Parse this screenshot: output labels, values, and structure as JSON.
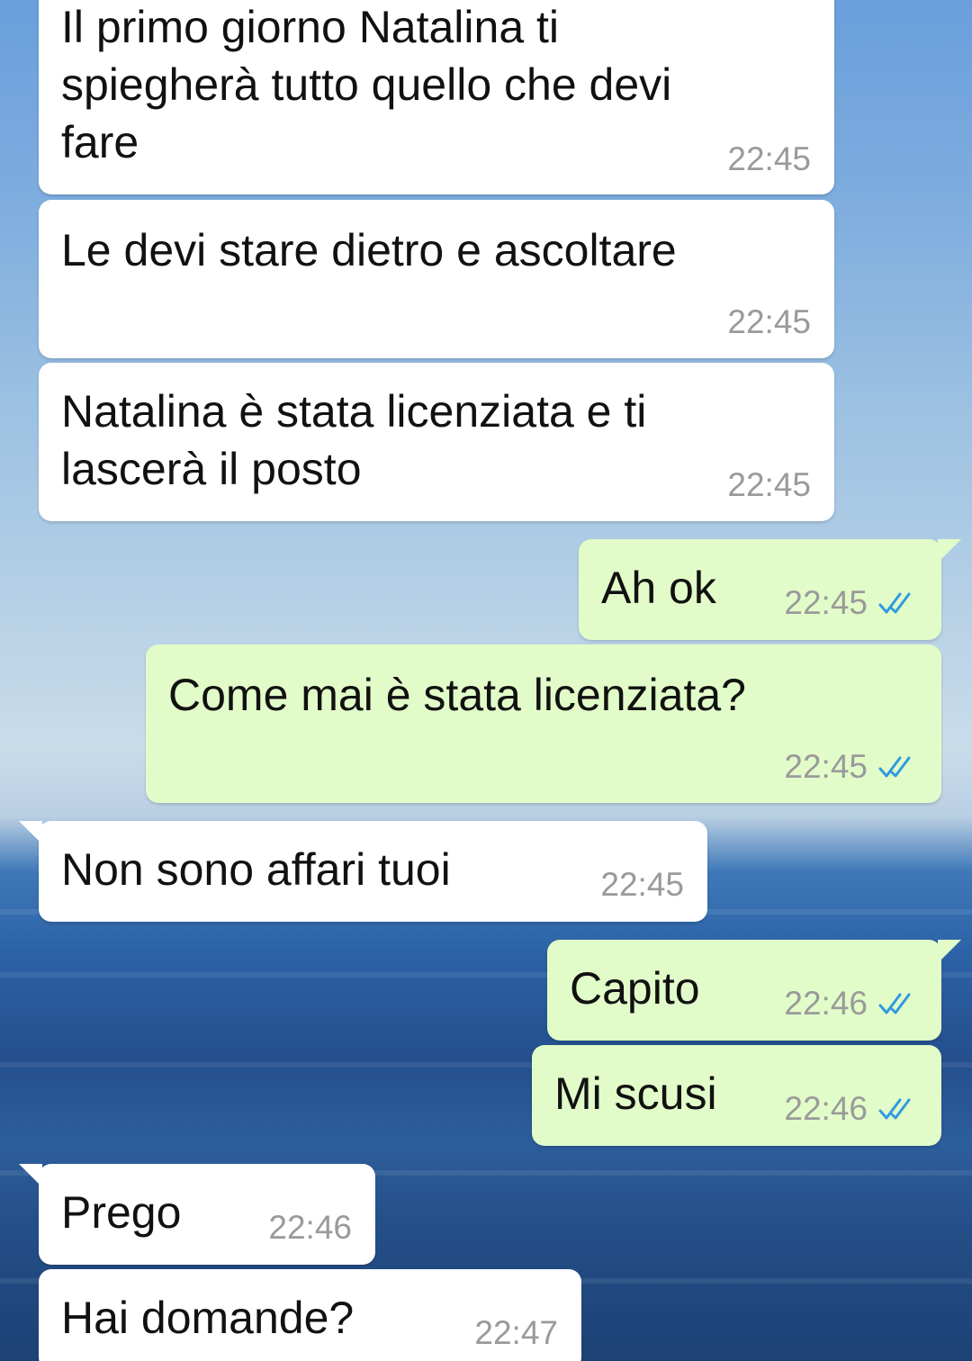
{
  "chat": {
    "messages": [
      {
        "direction": "in",
        "text": "Il primo giorno Natalina ti\nspiegherà tutto quello che devi\nfare",
        "time": "22:45"
      },
      {
        "direction": "in",
        "text": "Le devi stare dietro e ascoltare",
        "time": "22:45"
      },
      {
        "direction": "in",
        "text": "Natalina è stata licenziata e ti\nlascerà il posto",
        "time": "22:45"
      },
      {
        "direction": "out",
        "text": "Ah ok",
        "time": "22:45",
        "status": "read"
      },
      {
        "direction": "out",
        "text": "Come mai è stata licenziata?",
        "time": "22:45",
        "status": "read"
      },
      {
        "direction": "in",
        "text": "Non sono affari tuoi",
        "time": "22:45"
      },
      {
        "direction": "out",
        "text": "Capito",
        "time": "22:46",
        "status": "read"
      },
      {
        "direction": "out",
        "text": "Mi scusi",
        "time": "22:46",
        "status": "read"
      },
      {
        "direction": "in",
        "text": "Prego",
        "time": "22:46"
      },
      {
        "direction": "in",
        "text": "Hai domande?",
        "time": "22:47"
      }
    ]
  },
  "colors": {
    "incoming_bubble": "#ffffff",
    "outgoing_bubble": "#e2fcc9",
    "read_check": "#2f9be0",
    "timestamp": "#9a9a9a"
  },
  "icons": {
    "read_status": "double-check-icon"
  }
}
